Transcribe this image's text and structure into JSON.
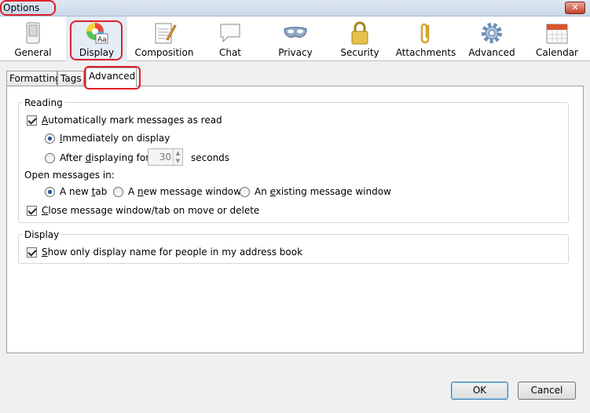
{
  "window": {
    "title": "Options",
    "close_glyph": "✕"
  },
  "toolbar": {
    "panes": [
      {
        "label": "General",
        "icon": "general-switch-icon"
      },
      {
        "label": "Display",
        "icon": "display-color-icon",
        "selected": true
      },
      {
        "label": "Composition",
        "icon": "composition-notepad-icon"
      },
      {
        "label": "Chat",
        "icon": "chat-bubble-icon"
      },
      {
        "label": "Privacy",
        "icon": "privacy-mask-icon"
      },
      {
        "label": "Security",
        "icon": "security-padlock-icon"
      },
      {
        "label": "Attachments",
        "icon": "attachments-paperclip-icon"
      },
      {
        "label": "Advanced",
        "icon": "advanced-gear-icon"
      },
      {
        "label": "Calendar",
        "icon": "calendar-icon"
      }
    ]
  },
  "tabs": {
    "formatting": "Formatting",
    "tags": "Tags",
    "advanced": "Advanced",
    "active": "Advanced"
  },
  "reading": {
    "caption": "Reading",
    "auto_mark_pre": "",
    "auto_mark_ul": "A",
    "auto_mark_post": "utomatically mark messages as read",
    "auto_mark_checked": true,
    "immediately_pre": "",
    "immediately_ul": "I",
    "immediately_post": "mmediately on display",
    "immediately_selected": true,
    "after_pre": "After ",
    "after_ul": "d",
    "after_post": "isplaying for",
    "after_selected": false,
    "seconds_value": "30",
    "seconds_label": "seconds"
  },
  "open_messages": {
    "label": "Open messages in:",
    "new_tab_pre": "A new ",
    "new_tab_ul": "t",
    "new_tab_post": "ab",
    "new_tab_selected": true,
    "new_window_pre": "A ",
    "new_window_ul": "n",
    "new_window_post": "ew message window",
    "new_window_selected": false,
    "existing_pre": "An ",
    "existing_ul": "e",
    "existing_post": "xisting message window",
    "existing_selected": false,
    "close_pre": "",
    "close_ul": "C",
    "close_post": "lose message window/tab on move or delete",
    "close_checked": true
  },
  "display": {
    "caption": "Display",
    "show_name_pre": "",
    "show_name_ul": "S",
    "show_name_post": "how only display name for people in my address book",
    "show_name_checked": true
  },
  "buttons": {
    "ok": "OK",
    "cancel": "Cancel"
  },
  "colors": {
    "highlight": "#e0202a",
    "title_bar": "#c9d8ea",
    "selected_pane": "#e4ecf5"
  }
}
